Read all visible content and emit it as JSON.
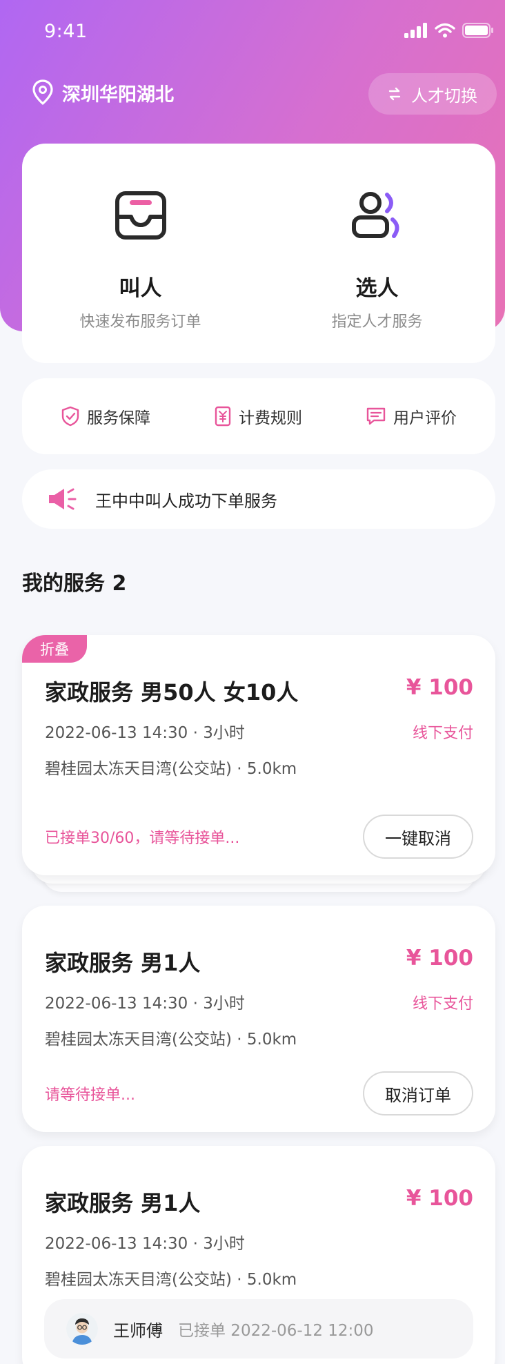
{
  "status_bar": {
    "time": "9:41"
  },
  "header": {
    "location": "深圳华阳湖北",
    "switch_label": "人才切换"
  },
  "actions": [
    {
      "icon": "inbox-icon",
      "title": "叫人",
      "subtitle": "快速发布服务订单"
    },
    {
      "icon": "users-icon",
      "title": "选人",
      "subtitle": "指定人才服务"
    }
  ],
  "features": [
    {
      "icon": "shield-check-icon",
      "label": "服务保障"
    },
    {
      "icon": "yuan-doc-icon",
      "label": "计费规则"
    },
    {
      "icon": "message-icon",
      "label": "用户评价"
    }
  ],
  "notice": {
    "icon": "megaphone-icon",
    "text": "王中中叫人成功下单服务"
  },
  "section": {
    "title": "我的服务 2"
  },
  "orders": [
    {
      "tag": "折叠",
      "title": "家政服务 男50人 女10人",
      "price": "¥ 100",
      "time": "2022-06-13 14:30 · 3小时",
      "payment": "线下支付",
      "address": "碧桂园太冻天目湾(公交站) · 5.0km",
      "status": "已接单30/60，请等待接单...",
      "button": "一键取消"
    },
    {
      "title": "家政服务 男1人",
      "price": "¥ 100",
      "time": "2022-06-13 14:30 · 3小时",
      "payment": "线下支付",
      "address": "碧桂园太冻天目湾(公交站) · 5.0km",
      "status": "请等待接单...",
      "button": "取消订单"
    },
    {
      "title": "家政服务 男1人",
      "price": "¥ 100",
      "time": "2022-06-13 14:30",
      "duration": "· 3小时",
      "address": "碧桂园太冻天目湾(公交站) · 5.0km",
      "worker": {
        "name": "王师傅",
        "status": "已接单 2022-06-12 12:00"
      }
    }
  ],
  "colors": {
    "accent": "#e8559a",
    "gradient_start": "#b067f2",
    "gradient_end": "#e872b5"
  }
}
